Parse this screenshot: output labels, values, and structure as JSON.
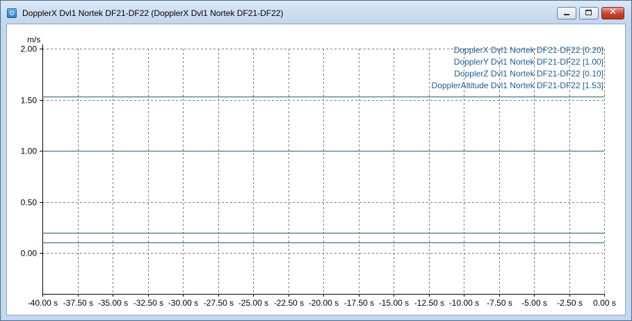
{
  "window": {
    "title": "DopplerX Dvl1 Nortek DF21-DF22 (DopplerX Dvl1 Nortek DF21-DF22)",
    "controls": {
      "minimize": "minimize-icon",
      "maximize": "maximize-icon",
      "close": "close-icon"
    }
  },
  "colors": {
    "series": "#1f5f73",
    "legend_text": "#1d5d8f",
    "grid": "#7a7a7a",
    "axis": "#000000"
  },
  "chart_data": {
    "type": "line",
    "ylabel": "m/s",
    "ylim": [
      -0.4,
      2.0
    ],
    "xlim": [
      -40.0,
      0.0
    ],
    "grid": true,
    "legend_position": "top-right",
    "y_ticks": [
      {
        "value": 2.0,
        "label": "2.00"
      },
      {
        "value": 1.5,
        "label": "1.50"
      },
      {
        "value": 1.0,
        "label": "1.00"
      },
      {
        "value": 0.5,
        "label": "0.50"
      },
      {
        "value": 0.0,
        "label": "0.00"
      }
    ],
    "x_ticks": [
      {
        "value": -40.0,
        "label": "-40.00 s"
      },
      {
        "value": -37.5,
        "label": "-37.50 s"
      },
      {
        "value": -35.0,
        "label": "-35.00 s"
      },
      {
        "value": -32.5,
        "label": "-32.50 s"
      },
      {
        "value": -30.0,
        "label": "-30.00 s"
      },
      {
        "value": -27.5,
        "label": "-27.50 s"
      },
      {
        "value": -25.0,
        "label": "-25.00 s"
      },
      {
        "value": -22.5,
        "label": "-22.50 s"
      },
      {
        "value": -20.0,
        "label": "-20.00 s"
      },
      {
        "value": -17.5,
        "label": "-17.50 s"
      },
      {
        "value": -15.0,
        "label": "-15.00 s"
      },
      {
        "value": -12.5,
        "label": "-12.50 s"
      },
      {
        "value": -10.0,
        "label": "-10.00 s"
      },
      {
        "value": -7.5,
        "label": "-7.50 s"
      },
      {
        "value": -5.0,
        "label": "-5.00 s"
      },
      {
        "value": -2.5,
        "label": "-2.50 s"
      },
      {
        "value": 0.0,
        "label": "0.00 s"
      }
    ],
    "series": [
      {
        "name": "DopplerX Dvl1 Nortek DF21-DF22 [0.20]",
        "x": [
          -40.0,
          0.0
        ],
        "y": [
          0.2,
          0.2
        ]
      },
      {
        "name": "DopplerY Dvl1 Nortek DF21-DF22 [1.00]",
        "x": [
          -40.0,
          0.0
        ],
        "y": [
          1.0,
          1.0
        ]
      },
      {
        "name": "DopplerZ Dvl1 Nortek DF21-DF22 [0.10]",
        "x": [
          -40.0,
          0.0
        ],
        "y": [
          0.1,
          0.1
        ]
      },
      {
        "name": "DopplerAltitude Dvl1 Nortek DF21-DF22 [1.53]",
        "x": [
          -40.0,
          0.0
        ],
        "y": [
          1.53,
          1.53
        ]
      }
    ]
  }
}
